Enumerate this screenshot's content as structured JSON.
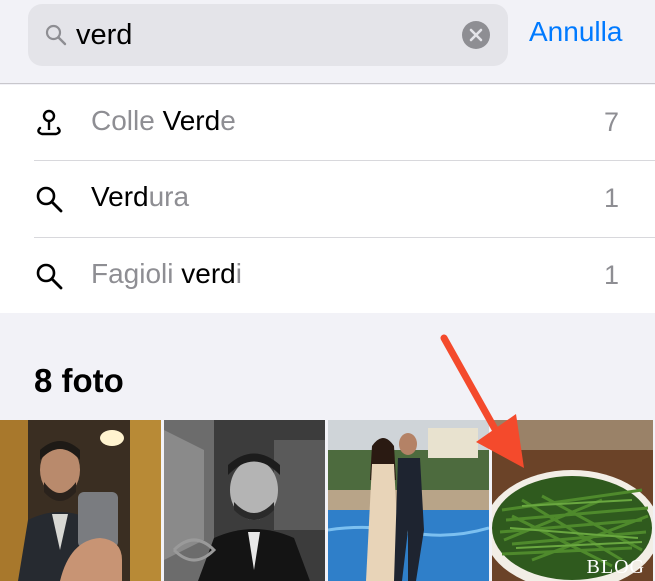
{
  "search": {
    "query": "verd",
    "cancel_label": "Annulla"
  },
  "suggestions": [
    {
      "icon": "location-pin-icon",
      "prefix": "Colle ",
      "match": "Verd",
      "suffix": "e",
      "count": "7"
    },
    {
      "icon": "search-icon",
      "prefix": "",
      "match": "Verd",
      "suffix": "ura",
      "count": "1"
    },
    {
      "icon": "search-icon",
      "prefix": "Fagioli ",
      "match": "verd",
      "suffix": "i",
      "count": "1"
    }
  ],
  "results": {
    "title": "8 foto",
    "watermark": "BLOG"
  },
  "colors": {
    "accent": "#007aff",
    "annotation_arrow": "#f44a2c"
  }
}
